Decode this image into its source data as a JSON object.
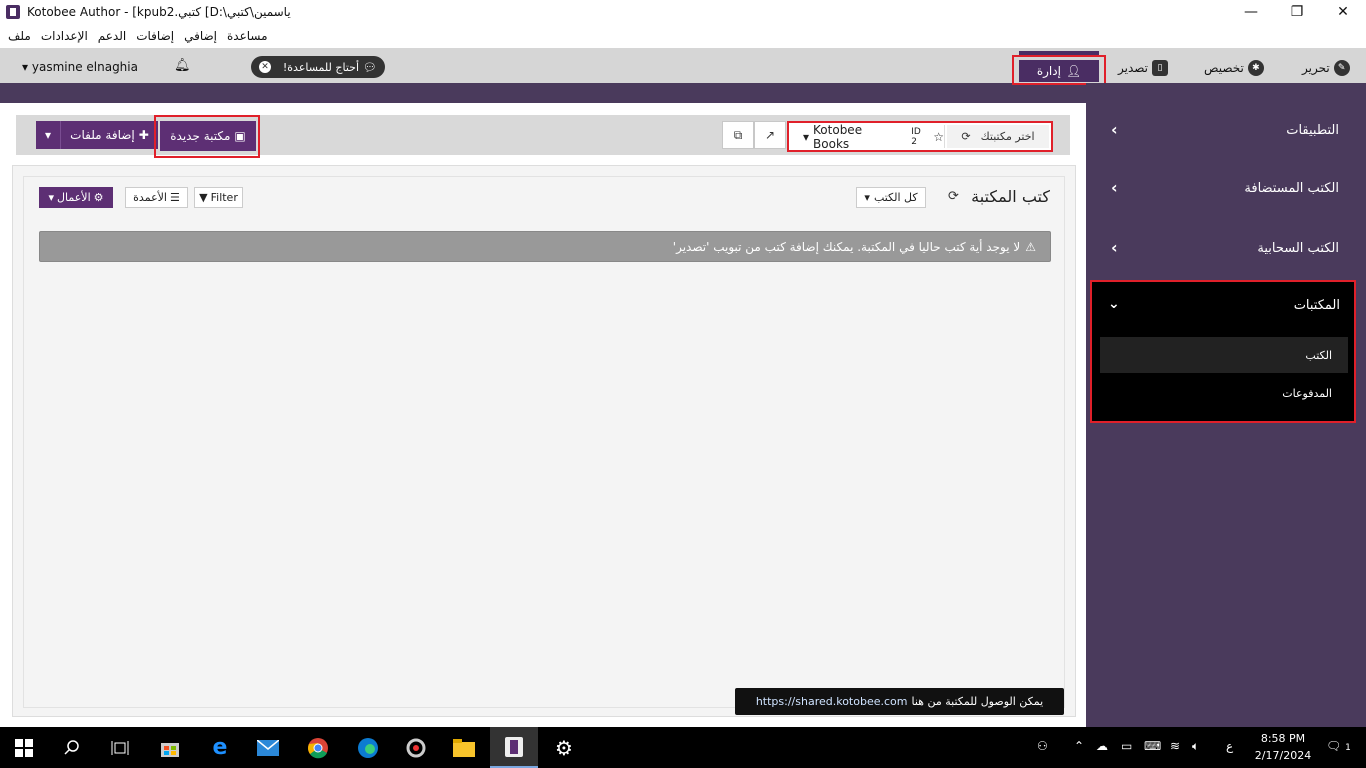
{
  "window": {
    "title": "Kotobee Author - [kpub2.كتبي [D:\\ياسمين\\كتبي",
    "minimize": "—",
    "maximize": "❐",
    "close": "✕"
  },
  "menubar": [
    "ملف",
    "الإعدادات",
    "الدعم",
    "إضافات",
    "إضافي",
    "مساعدة"
  ],
  "header": {
    "user": "yasmine elnaghia",
    "help_label": "أحتاج للمساعدة!",
    "nav": {
      "edit": "تحرير",
      "customize": "تخصيص",
      "export": "تصدير",
      "manage": "إدارة"
    }
  },
  "toolbar": {
    "add_files": "إضافة ملفات",
    "new_library": "مكتبة جديدة",
    "library_name": "Kotobee Books",
    "library_id": "ID 2",
    "choose_library": "اختر مكتبتك"
  },
  "panel": {
    "title": "كتب المكتبة",
    "filter_select": "كل الكتب",
    "filter": "Filter",
    "columns": "الأعمدة",
    "actions": "الأعمال",
    "alert": "لا يوجد أية كتب حاليا في المكتبة. يمكنك إضافة كتب من تبويب 'تصدير'"
  },
  "tooltip": {
    "text": "يمكن الوصول للمكتبة من هنا",
    "url": "https://shared.kotobee.com"
  },
  "sidebar": {
    "items": [
      {
        "label": "التطبيقات"
      },
      {
        "label": "الكتب المستضافة"
      },
      {
        "label": "الكتب السحابية"
      }
    ],
    "active": {
      "label": "المكتبات",
      "subitems": [
        "الكتب",
        "المدفوعات"
      ]
    }
  },
  "taskbar": {
    "time": "8:58 PM",
    "date": "2/17/2024",
    "lang": "ع",
    "notifications": "1"
  },
  "colors": {
    "accent": "#5d2f74",
    "highlight": "#e0202a",
    "sidebar": "#4a3a5c"
  }
}
